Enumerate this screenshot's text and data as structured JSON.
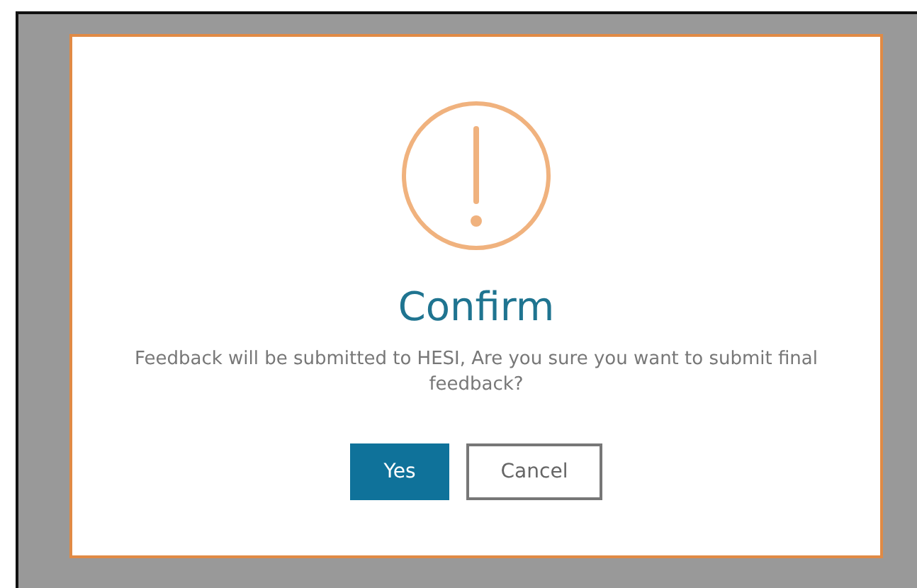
{
  "dialog": {
    "title": "Confirm",
    "message": "Feedback will be submitted to HESI, Are you sure you want to submit final feedback?",
    "buttons": [
      {
        "label": "Yes",
        "kind": "primary"
      },
      {
        "label": "Cancel",
        "kind": "secondary"
      }
    ]
  }
}
